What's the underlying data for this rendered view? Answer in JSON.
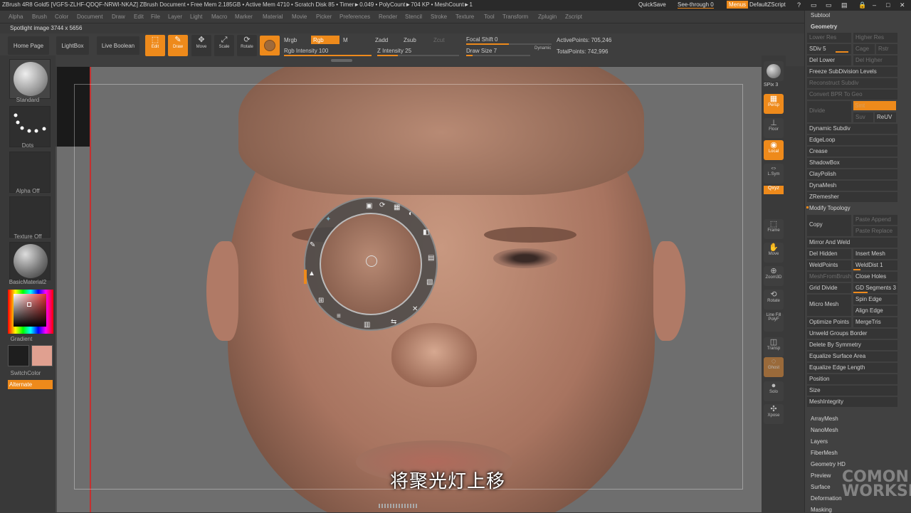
{
  "title_bar": {
    "text": "ZBrush 4R8 Gold5 [VGFS-ZLHF-QDQF-NRWI-NKAZ]   ZBrush Document   • Free Mem 2.185GB • Active Mem 4710 • Scratch Disk 85 • Timer►0.049 • PolyCount►704 KP • MeshCount►1",
    "quicksave": "QuickSave",
    "see_through": "See-through  0",
    "menus": "Menus",
    "script": "DefaultZScript"
  },
  "menu_bar": [
    "Alpha",
    "Brush",
    "Color",
    "Document",
    "Draw",
    "Edit",
    "File",
    "Layer",
    "Light",
    "Macro",
    "Marker",
    "Material",
    "Movie",
    "Picker",
    "Preferences",
    "Render",
    "Stencil",
    "Stroke",
    "Texture",
    "Tool",
    "Transform",
    "Zplugin",
    "Zscript"
  ],
  "spotlight_info": "Spotlight image 3744 x 5656",
  "toolbar": {
    "home": "Home Page",
    "lightbox": "LightBox",
    "live_boolean": "Live Boolean",
    "edit": "Edit",
    "draw": "Draw",
    "move": "Move",
    "scale": "Scale",
    "rotate": "Rotate",
    "mrgb": "Mrgb",
    "rgb": "Rgb",
    "m": "M",
    "zadd": "Zadd",
    "zsub": "Zsub",
    "zcut": "Zcut",
    "rgb_intensity": "Rgb Intensity 100",
    "z_intensity": "Z Intensity 25",
    "focal_shift": "Focal Shift 0",
    "draw_size": "Draw Size 7",
    "dynamic": "Dynamic",
    "active_points": "ActivePoints: 705,246",
    "total_points": "TotalPoints: 742,996",
    "rgb_intensity_value": 1.0,
    "z_intensity_value": 0.25,
    "draw_size_value": 0.1
  },
  "left_shelf": {
    "brush": "Standard",
    "stroke": "Dots",
    "alpha": "Alpha Off",
    "texture": "Texture Off",
    "material": "BasicMaterial2",
    "gradient": "Gradient",
    "switch_color": "SwitchColor",
    "alternate": "Alternate",
    "colors": {
      "main": "#1e1e1e",
      "secondary": "#e0a090"
    }
  },
  "right_shelf": [
    "BPR",
    "SPix 3",
    "Persp",
    "Floor",
    "Local",
    "L.Sym",
    "Qxyz",
    "Frame",
    "Move",
    "Zoom3D",
    "Rotate",
    "Line Fill PolyF",
    "Transp",
    "Ghost",
    "Solo",
    "Xpose"
  ],
  "right_panel": {
    "subtool": "Subtool",
    "geometry": "Geometry",
    "lower_res": "Lower Res",
    "higher_res": "Higher Res",
    "sdiv": "SDiv 5",
    "cage": "Cage",
    "rstr": "Rstr",
    "del_lower": "Del Lower",
    "del_higher": "Del Higher",
    "freeze": "Freeze SubDivision Levels",
    "reconstruct": "Reconstruct Subdiv",
    "convert_bpr": "Convert BPR To Geo",
    "divide": "Divide",
    "smt": "Smt",
    "suv": "Suv",
    "reuv": "ReUV",
    "items_a": [
      "Dynamic Subdiv",
      "EdgeLoop",
      "Crease",
      "ShadowBox",
      "ClayPolish",
      "DynaMesh",
      "ZRemesher"
    ],
    "modify_topology": "Modify Topology",
    "copy": "Copy",
    "paste_append": "Paste Append",
    "paste_replace": "Paste Replace",
    "mirror_weld": "Mirror And Weld",
    "del_hidden": "Del Hidden",
    "insert_mesh": "Insert Mesh",
    "weld_points": "WeldPoints",
    "weld_dist": "WeldDist 1",
    "mesh_from_brush": "MeshFromBrush",
    "close_holes": "Close Holes",
    "grid_divide": "Grid Divide",
    "gd_segments": "GD Segments 3",
    "micro_mesh": "Micro Mesh",
    "spin_edge": "Spin Edge",
    "align_edge": "Align Edge",
    "optimize_points": "Optimize Points",
    "merge_tris": "MergeTris",
    "unweld": "Unweld Groups Border",
    "delete_symmetry": "Delete By Symmetry",
    "equalize_area": "Equalize Surface Area",
    "equalize_edge": "Equalize Edge Length",
    "position": "Position",
    "size": "Size",
    "mesh_integrity": "MeshIntegrity",
    "items_b": [
      "ArrayMesh",
      "NanoMesh",
      "Layers",
      "FiberMesh",
      "Geometry HD",
      "Preview",
      "Surface",
      "Deformation",
      "Masking"
    ]
  },
  "subtitle": "将聚光灯上移",
  "watermark": "COMON WORKSHOP"
}
